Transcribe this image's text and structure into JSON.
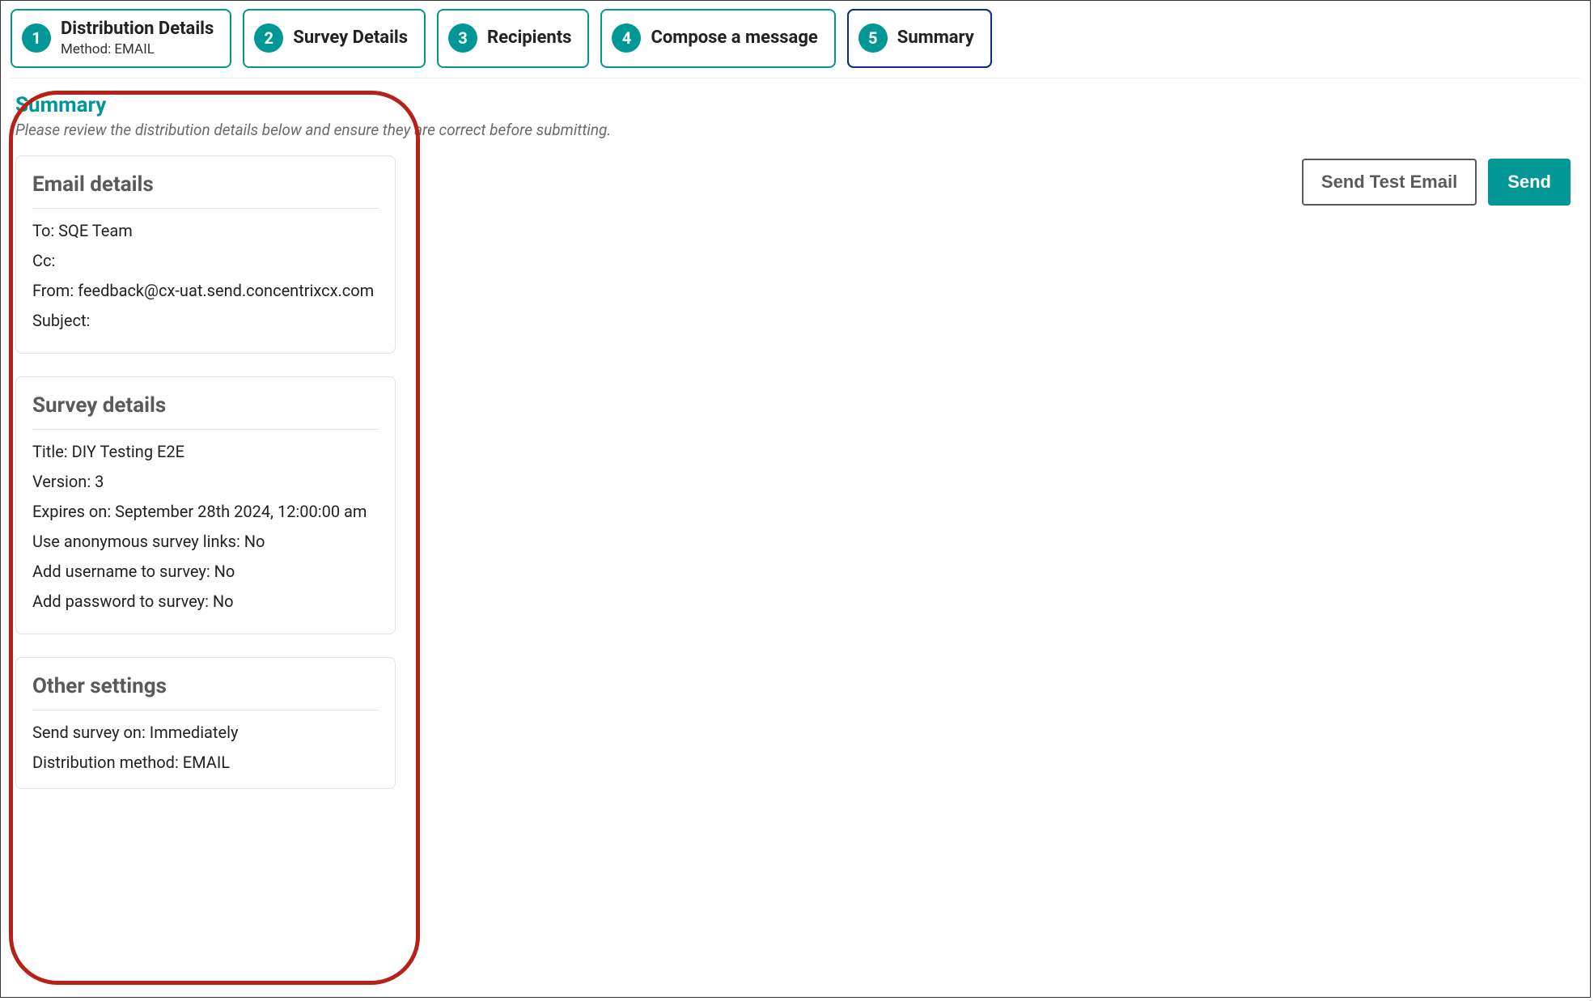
{
  "stepper": {
    "steps": [
      {
        "num": "1",
        "title": "Distribution Details",
        "sub": "Method: EMAIL",
        "active": false
      },
      {
        "num": "2",
        "title": "Survey Details",
        "sub": "",
        "active": false
      },
      {
        "num": "3",
        "title": "Recipients",
        "sub": "",
        "active": false
      },
      {
        "num": "4",
        "title": "Compose a message",
        "sub": "",
        "active": false
      },
      {
        "num": "5",
        "title": "Summary",
        "sub": "",
        "active": true
      }
    ]
  },
  "heading": "Summary",
  "subheading": "Please review the distribution details below and ensure they are correct before submitting.",
  "email_details": {
    "title": "Email details",
    "to": "To: SQE Team",
    "cc": "Cc:",
    "from": "From: feedback@cx-uat.send.concentrixcx.com",
    "subject": "Subject:"
  },
  "survey_details": {
    "title": "Survey details",
    "title_row": "Title: DIY Testing E2E",
    "version": "Version: 3",
    "expires": "Expires on: September 28th 2024, 12:00:00 am",
    "anon": "Use anonymous survey links: No",
    "username": "Add username to survey: No",
    "password": "Add password to survey: No"
  },
  "other_settings": {
    "title": "Other settings",
    "send_on": "Send survey on: Immediately",
    "method": "Distribution method: EMAIL"
  },
  "actions": {
    "send_test": "Send Test Email",
    "send": "Send"
  }
}
